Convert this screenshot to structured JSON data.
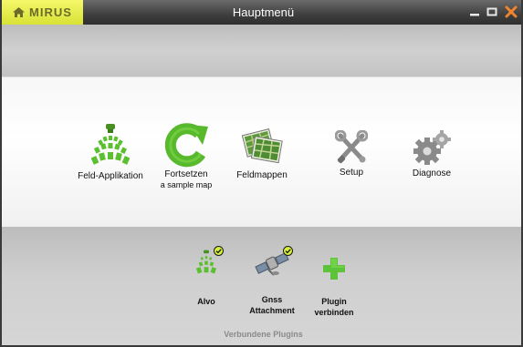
{
  "app": {
    "logo_text": "MIRUS",
    "title": "Hauptmenü"
  },
  "window_controls": {
    "minimize": "minimize",
    "maximize": "maximize",
    "close": "close"
  },
  "colors": {
    "logo_bg": "#e6ee4a",
    "accent_green": "#58b92d",
    "close_orange": "#f0852d",
    "check_yellow": "#d7f03a"
  },
  "main_menu": {
    "items": [
      {
        "label": "Feld-Applikation",
        "icon": "sprayer-icon"
      },
      {
        "label": "Fortsetzen",
        "sublabel": "a sample map",
        "icon": "resume-arrow-icon"
      },
      {
        "label": "Feldmappen",
        "icon": "field-maps-icon"
      },
      {
        "label": "Setup",
        "icon": "tools-icon"
      },
      {
        "label": "Diagnose",
        "icon": "gears-icon"
      }
    ]
  },
  "plugins": {
    "section_label": "Verbundene Plugins",
    "items": [
      {
        "label": "Alvo",
        "icon": "sprayer-icon",
        "connected": true
      },
      {
        "label": "Gnss\nAttachment",
        "icon": "satellite-icon",
        "connected": true
      },
      {
        "label": "Plugin\nverbinden",
        "icon": "plus-icon",
        "connected": false
      }
    ]
  }
}
